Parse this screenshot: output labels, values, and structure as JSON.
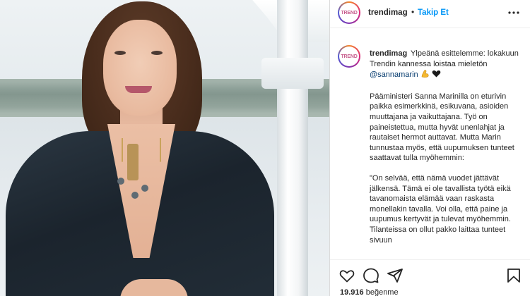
{
  "post": {
    "username": "trendimag",
    "avatar_text": "TREND",
    "follow_label": "Takip Et",
    "separator": "•",
    "caption_intro": "Ylpeänä esittelemme: lokakuun Trendin kannessa loistaa mieletön",
    "mention": "@sannamarin",
    "caption_para2": "Pääministeri Sanna Marinilla on eturivin paikka esimerkkinä, esikuvana, asioiden muuttajana ja vaikuttajana. Työ on paineistettua, mutta hyvät unenlahjat ja rautaiset hermot auttavat. Mutta Marin tunnustaa myös, että uupumuksen tunteet saattavat tulla myöhemmin:",
    "caption_para3": "\"On selvää, että nämä vuodet jättävät jälkensä. Tämä ei ole tavallista työtä eikä tavanomaista elämää vaan raskasta monellakin tavalla. Voi olla, että paine ja uupumus kertyvät ja tulevat myöhemmin. Tilanteissa on ollut pakko laittaa tunteet sivuun",
    "likes_count": "19.916",
    "likes_label": "beğenme"
  },
  "icons": {
    "more": "more-horizontal-icon",
    "like": "heart-icon",
    "comment": "comment-icon",
    "share": "share-icon",
    "save": "bookmark-icon",
    "emoji1": "flexed-biceps-emoji",
    "emoji2": "black-heart-emoji"
  },
  "colors": {
    "follow": "#0095f6",
    "mention": "#00376b",
    "text": "#262626"
  }
}
